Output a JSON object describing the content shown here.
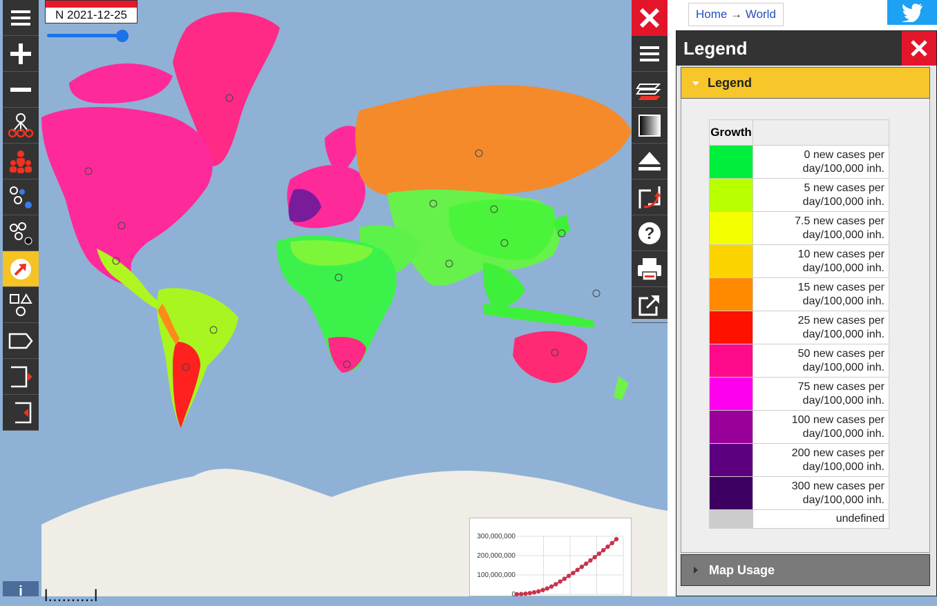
{
  "date_control": {
    "date": "N 2021-12-25",
    "slider_fraction": 0.92
  },
  "breadcrumb": {
    "home": "Home",
    "arrow": "→",
    "world": "World"
  },
  "legend_dialog": {
    "title": "Legend",
    "tab_label": "Legend",
    "column_header": "Growth",
    "rows": [
      {
        "color": "#00ee3c",
        "label_line1": "0 new cases per",
        "label_line2": "day/100,000 inh."
      },
      {
        "color": "#b8ff00",
        "label_line1": "5 new cases per",
        "label_line2": "day/100,000 inh."
      },
      {
        "color": "#f4ff00",
        "label_line1": "7.5 new cases per",
        "label_line2": "day/100,000 inh."
      },
      {
        "color": "#fbd400",
        "label_line1": "10 new cases per",
        "label_line2": "day/100,000 inh."
      },
      {
        "color": "#ff8a00",
        "label_line1": "15 new cases per",
        "label_line2": "day/100,000 inh."
      },
      {
        "color": "#ff1100",
        "label_line1": "25 new cases per",
        "label_line2": "day/100,000 inh."
      },
      {
        "color": "#ff0a8c",
        "label_line1": "50 new cases per",
        "label_line2": "day/100,000 inh."
      },
      {
        "color": "#ff00ee",
        "label_line1": "75 new cases per",
        "label_line2": "day/100,000 inh."
      },
      {
        "color": "#990099",
        "label_line1": "100 new cases per",
        "label_line2": "day/100,000 inh."
      },
      {
        "color": "#5c0080",
        "label_line1": "200 new cases per",
        "label_line2": "day/100,000 inh."
      },
      {
        "color": "#3d0060",
        "label_line1": "300 new cases per",
        "label_line2": "day/100,000 inh."
      }
    ],
    "undefined_row": {
      "color": "#cccccc",
      "label": "undefined"
    },
    "map_usage_label": "Map Usage"
  },
  "mini_chart": {
    "y_ticks": [
      "300,000,000",
      "200,000,000",
      "100,000,000",
      "0"
    ],
    "series_values": [
      0,
      1,
      3,
      6,
      10,
      15,
      22,
      30,
      40,
      52,
      66,
      80,
      95,
      110,
      126,
      142,
      158,
      175,
      192,
      210,
      228,
      246,
      265,
      285
    ]
  },
  "bottom_text": "l..........l",
  "colors": {
    "ocean": "#8fb1d6",
    "toolbar": "#333333",
    "accent": "#f6c224",
    "close": "#e3152b",
    "twitter": "#1da1f2"
  }
}
